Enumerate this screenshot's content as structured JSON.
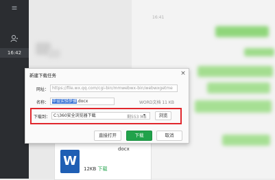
{
  "sidebar": {
    "menu_icon": "≡",
    "time": "16:42"
  },
  "chat": {
    "top_time": "16:41",
    "file_card": {
      "name": "docx",
      "icon_letter": "W",
      "size": "12KB",
      "download": "下载"
    }
  },
  "dialog": {
    "title": "新建下载任务",
    "close": "×",
    "url_label": "网址：",
    "url_value": "https://file.wx.qq.com/cgi-bin/mmwebwx-bin/webwxgetme",
    "name_label": "名称：",
    "name_selected": "毕设实验步骤",
    "name_ext": ".docx",
    "file_info": "WORD文档 11 KB",
    "dest_label": "下载到：",
    "dest_value": "C:\\360安全浏览器下载",
    "free_space": "剩553 MB",
    "browse_label": "浏览",
    "direct_open_label": "直接打开",
    "download_label": "下载",
    "cancel_label": "取消"
  },
  "colors": {
    "accent_green": "#21a24b",
    "highlight_red": "#e0262c",
    "selection_blue": "#3b76d6"
  }
}
